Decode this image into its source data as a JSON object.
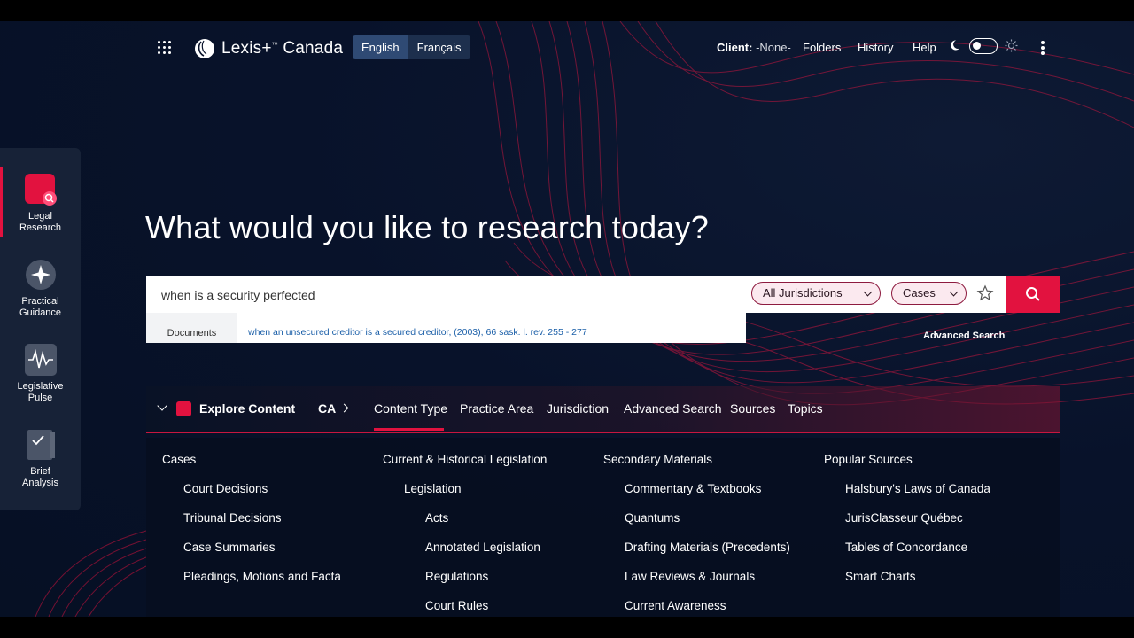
{
  "header": {
    "brand": "Lexis+",
    "brand_sup": "™",
    "brand_region": "Canada",
    "languages": [
      "English",
      "Français"
    ],
    "client_label": "Client:",
    "client_value": "-None-",
    "nav": [
      "Folders",
      "History",
      "Help"
    ],
    "icons": [
      "apps-grid-icon",
      "moon-icon",
      "sun-icon",
      "more-vertical-icon"
    ]
  },
  "sidebar": {
    "items": [
      {
        "label1": "Legal",
        "label2": "Research",
        "icon": "legal-research-icon",
        "active": true
      },
      {
        "label1": "Practical",
        "label2": "Guidance",
        "icon": "practical-guidance-icon"
      },
      {
        "label1": "Legislative",
        "label2": "Pulse",
        "icon": "legislative-pulse-icon"
      },
      {
        "label1": "Brief",
        "label2": "Analysis",
        "icon": "brief-analysis-icon"
      }
    ]
  },
  "hero": {
    "title": "What would you like to research today?"
  },
  "search": {
    "value": "when is a security perfected",
    "jurisdiction": "All Jurisdictions",
    "content_type": "Cases",
    "suggestion_category": "Documents",
    "suggestion_text": "when an unsecured creditor is a secured creditor, (2003), 66 sask. l. rev. 255 - 277",
    "advanced_link": "Advanced Search"
  },
  "explore": {
    "title": "Explore Content",
    "region": "CA",
    "tabs": [
      "Content Type",
      "Practice Area",
      "Jurisdiction",
      "Advanced Search",
      "Sources",
      "Topics"
    ],
    "active_tab": "Content Type",
    "columns": [
      {
        "heading": "Cases",
        "items": [
          {
            "label": "Court Decisions",
            "level": 1
          },
          {
            "label": "Tribunal Decisions",
            "level": 1
          },
          {
            "label": "Case Summaries",
            "level": 1
          },
          {
            "label": "Pleadings, Motions and Facta",
            "level": 1
          }
        ]
      },
      {
        "heading": "Current & Historical Legislation",
        "items": [
          {
            "label": "Legislation",
            "level": 1
          },
          {
            "label": "Acts",
            "level": 2
          },
          {
            "label": "Annotated Legislation",
            "level": 2
          },
          {
            "label": "Regulations",
            "level": 2
          },
          {
            "label": "Court Rules",
            "level": 2
          }
        ]
      },
      {
        "heading": "Secondary Materials",
        "items": [
          {
            "label": "Commentary & Textbooks",
            "level": 1
          },
          {
            "label": "Quantums",
            "level": 1
          },
          {
            "label": "Drafting Materials (Precedents)",
            "level": 1
          },
          {
            "label": "Law Reviews & Journals",
            "level": 1
          },
          {
            "label": "Current Awareness",
            "level": 1
          }
        ]
      },
      {
        "heading": "Popular Sources",
        "items": [
          {
            "label": "Halsbury's Laws of Canada",
            "level": 1
          },
          {
            "label": "JurisClasseur Québec",
            "level": 1
          },
          {
            "label": "Tables of Concordance",
            "level": 1
          },
          {
            "label": "Smart Charts",
            "level": 1
          }
        ]
      }
    ]
  },
  "colors": {
    "accent": "#e2123f",
    "background": "#08122a",
    "panel": "#192438"
  }
}
